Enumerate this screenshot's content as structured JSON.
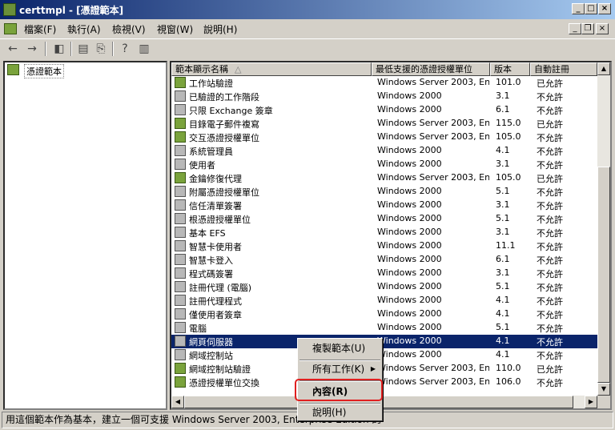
{
  "window": {
    "title": "certtmpl - [憑證範本]"
  },
  "menu": [
    "檔案(F)",
    "執行(A)",
    "檢視(V)",
    "視窗(W)",
    "說明(H)"
  ],
  "tree": {
    "root": "憑證範本"
  },
  "columns": [
    "範本顯示名稱",
    "最低支援的憑證授權單位",
    "版本",
    "自動註冊"
  ],
  "rows": [
    {
      "name": "工作站驗證",
      "ca": "Windows Server 2003, Ent...",
      "version": "101.0",
      "auto": "已允許",
      "enabled": true
    },
    {
      "name": "已驗證的工作階段",
      "ca": "Windows 2000",
      "version": "3.1",
      "auto": "不允許",
      "enabled": false
    },
    {
      "name": "只限 Exchange 簽章",
      "ca": "Windows 2000",
      "version": "6.1",
      "auto": "不允許",
      "enabled": false
    },
    {
      "name": "目錄電子郵件複寫",
      "ca": "Windows Server 2003, Ent...",
      "version": "115.0",
      "auto": "已允許",
      "enabled": true
    },
    {
      "name": "交互憑證授權單位",
      "ca": "Windows Server 2003, Ent...",
      "version": "105.0",
      "auto": "不允許",
      "enabled": true
    },
    {
      "name": "系統管理員",
      "ca": "Windows 2000",
      "version": "4.1",
      "auto": "不允許",
      "enabled": false
    },
    {
      "name": "使用者",
      "ca": "Windows 2000",
      "version": "3.1",
      "auto": "不允許",
      "enabled": false
    },
    {
      "name": "金鑰修復代理",
      "ca": "Windows Server 2003, Ent...",
      "version": "105.0",
      "auto": "已允許",
      "enabled": true
    },
    {
      "name": "附屬憑證授權單位",
      "ca": "Windows 2000",
      "version": "5.1",
      "auto": "不允許",
      "enabled": false
    },
    {
      "name": "信任清單簽署",
      "ca": "Windows 2000",
      "version": "3.1",
      "auto": "不允許",
      "enabled": false
    },
    {
      "name": "根憑證授權單位",
      "ca": "Windows 2000",
      "version": "5.1",
      "auto": "不允許",
      "enabled": false
    },
    {
      "name": "基本 EFS",
      "ca": "Windows 2000",
      "version": "3.1",
      "auto": "不允許",
      "enabled": false
    },
    {
      "name": "智慧卡使用者",
      "ca": "Windows 2000",
      "version": "11.1",
      "auto": "不允許",
      "enabled": false
    },
    {
      "name": "智慧卡登入",
      "ca": "Windows 2000",
      "version": "6.1",
      "auto": "不允許",
      "enabled": false
    },
    {
      "name": "程式碼簽署",
      "ca": "Windows 2000",
      "version": "3.1",
      "auto": "不允許",
      "enabled": false
    },
    {
      "name": "註冊代理 (電腦)",
      "ca": "Windows 2000",
      "version": "5.1",
      "auto": "不允許",
      "enabled": false
    },
    {
      "name": "註冊代理程式",
      "ca": "Windows 2000",
      "version": "4.1",
      "auto": "不允許",
      "enabled": false
    },
    {
      "name": "僅使用者簽章",
      "ca": "Windows 2000",
      "version": "4.1",
      "auto": "不允許",
      "enabled": false
    },
    {
      "name": "電腦",
      "ca": "Windows 2000",
      "version": "5.1",
      "auto": "不允許",
      "enabled": false
    },
    {
      "name": "網頁伺服器",
      "ca": "Windows 2000",
      "version": "4.1",
      "auto": "不允許",
      "enabled": false,
      "selected": true
    },
    {
      "name": "網域控制站",
      "ca": "Windows 2000",
      "version": "4.1",
      "auto": "不允許",
      "enabled": false
    },
    {
      "name": "網域控制站驗證",
      "ca": "Windows Server 2003, Ent...",
      "version": "110.0",
      "auto": "已允許",
      "enabled": true
    },
    {
      "name": "憑證授權單位交換",
      "ca": "Windows Server 2003, Ent...",
      "version": "106.0",
      "auto": "不允許",
      "enabled": true
    }
  ],
  "context_menu": {
    "copy": "複製範本(U)",
    "all_tasks": "所有工作(K)",
    "properties": "內容(R)",
    "help": "說明(H)"
  },
  "status": "用這個範本作為基本，建立一個可支援 Windows Server 2003, Enterprise Edition 的"
}
